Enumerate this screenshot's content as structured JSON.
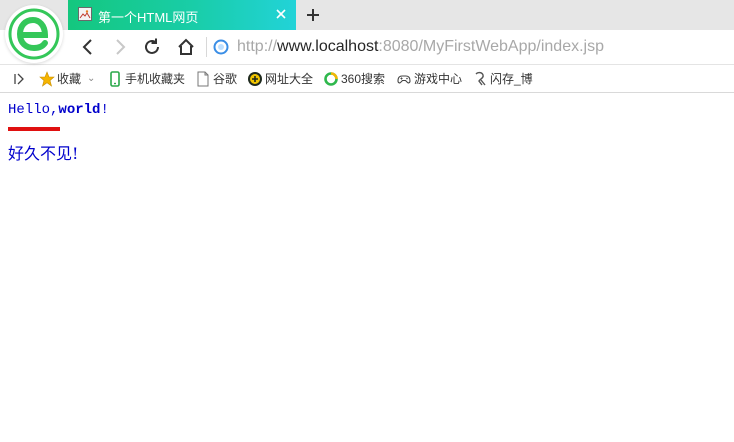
{
  "browser": {
    "tab": {
      "title": "第一个HTML网页"
    },
    "url": {
      "scheme": "http://",
      "host": "www.localhost",
      "rest": ":8080/MyFirstWebApp/index.jsp"
    },
    "bookmarks": [
      {
        "label": "收藏",
        "icon": "star-icon"
      },
      {
        "label": "手机收藏夹",
        "icon": "phone-icon"
      },
      {
        "label": "谷歌",
        "icon": "document-icon"
      },
      {
        "label": "网址大全",
        "icon": "web-directory-icon"
      },
      {
        "label": "360搜索",
        "icon": "search-360-icon"
      },
      {
        "label": "游戏中心",
        "icon": "gamepad-icon"
      },
      {
        "label": "闪存_博",
        "icon": "flash-icon"
      }
    ]
  },
  "page": {
    "hello_prefix": "Hello,",
    "hello_bold": "world",
    "hello_suffix": "!",
    "second_line": "好久不见!"
  },
  "colors": {
    "tab_gradient_start": "#14c77e",
    "tab_gradient_end": "#22d3d8",
    "logo_green": "#34c759",
    "page_text_blue": "#0000cc",
    "underline_red": "#e01010"
  }
}
